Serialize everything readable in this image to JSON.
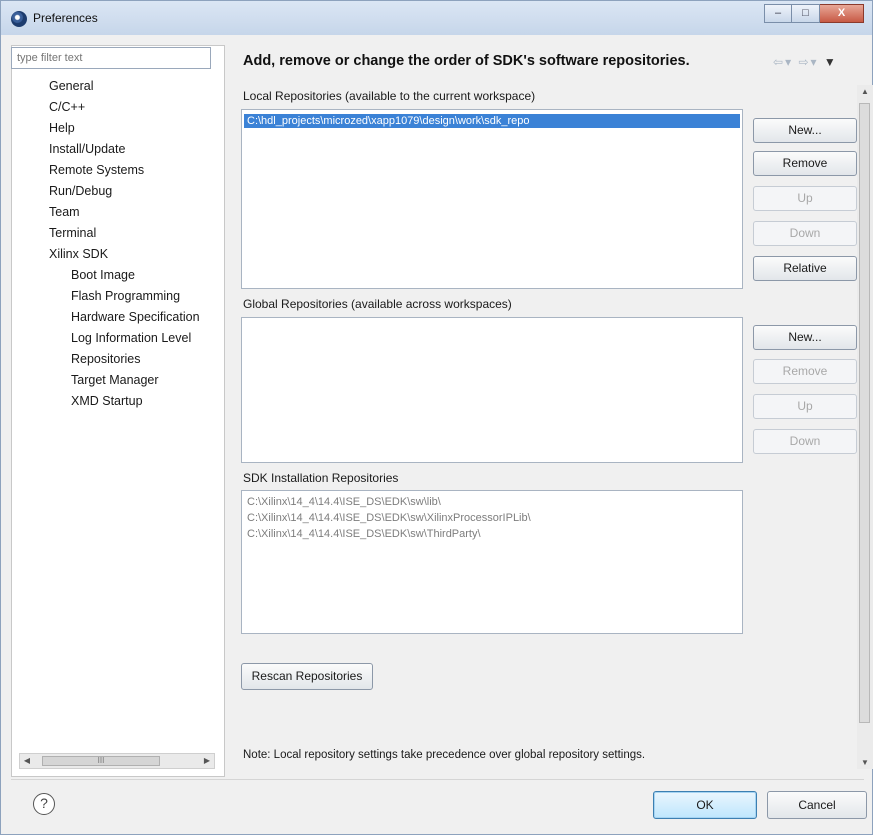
{
  "window": {
    "title": "Preferences",
    "min_glyph": "–",
    "max_glyph": "□",
    "close_glyph": "X"
  },
  "sidebar": {
    "filter_placeholder": "type filter text",
    "items": [
      {
        "label": "General",
        "level": 0
      },
      {
        "label": "C/C++",
        "level": 0
      },
      {
        "label": "Help",
        "level": 0
      },
      {
        "label": "Install/Update",
        "level": 0
      },
      {
        "label": "Remote Systems",
        "level": 0
      },
      {
        "label": "Run/Debug",
        "level": 0
      },
      {
        "label": "Team",
        "level": 0
      },
      {
        "label": "Terminal",
        "level": 0
      },
      {
        "label": "Xilinx SDK",
        "level": 0
      },
      {
        "label": "Boot Image",
        "level": 1
      },
      {
        "label": "Flash Programming",
        "level": 1
      },
      {
        "label": "Hardware Specification",
        "level": 1
      },
      {
        "label": "Log Information Level",
        "level": 1
      },
      {
        "label": "Repositories",
        "level": 1
      },
      {
        "label": "Target Manager",
        "level": 1
      },
      {
        "label": "XMD Startup",
        "level": 1
      }
    ],
    "scroll_thumb_glyph": "III"
  },
  "main": {
    "title": "Add, remove or change the order of SDK's software repositories.",
    "local": {
      "label": "Local Repositories (available to the current workspace)",
      "items": [
        "C:\\hdl_projects\\microzed\\xapp1079\\design\\work\\sdk_repo"
      ],
      "buttons": [
        {
          "label": "New...",
          "enabled": true
        },
        {
          "label": "Remove",
          "enabled": true
        },
        {
          "label": "Up",
          "enabled": false
        },
        {
          "label": "Down",
          "enabled": false
        },
        {
          "label": "Relative",
          "enabled": true
        }
      ]
    },
    "global": {
      "label": "Global Repositories (available across workspaces)",
      "items": [],
      "buttons": [
        {
          "label": "New...",
          "enabled": true
        },
        {
          "label": "Remove",
          "enabled": false
        },
        {
          "label": "Up",
          "enabled": false
        },
        {
          "label": "Down",
          "enabled": false
        }
      ]
    },
    "sdk": {
      "label": "SDK Installation Repositories",
      "items": [
        "C:\\Xilinx\\14_4\\14.4\\ISE_DS\\EDK\\sw\\lib\\",
        "C:\\Xilinx\\14_4\\14.4\\ISE_DS\\EDK\\sw\\XilinxProcessorIPLib\\",
        "C:\\Xilinx\\14_4\\14.4\\ISE_DS\\EDK\\sw\\ThirdParty\\"
      ]
    },
    "rescan_label": "Rescan Repositories",
    "note": "Note: Local repository settings take precedence over global repository settings."
  },
  "footer": {
    "help_glyph": "?",
    "ok_label": "OK",
    "cancel_label": "Cancel"
  }
}
